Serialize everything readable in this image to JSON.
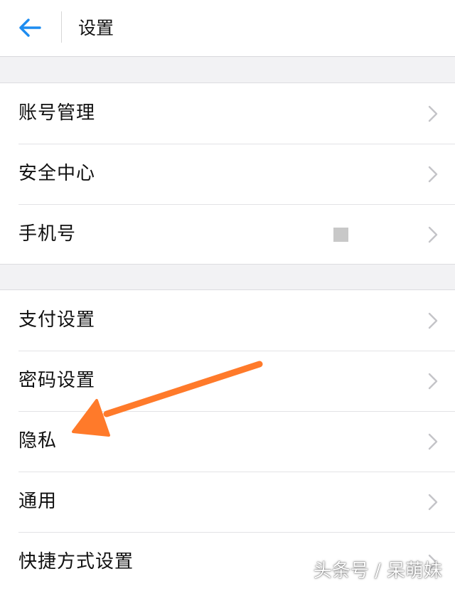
{
  "header": {
    "title": "设置",
    "back_icon": "back-arrow-icon",
    "accent_color": "#1d8cf0"
  },
  "groups": [
    {
      "items": [
        {
          "label": "账号管理",
          "icon": "chevron-right-icon"
        },
        {
          "label": "安全中心",
          "icon": "chevron-right-icon"
        },
        {
          "label": "手机号",
          "icon": "chevron-right-icon",
          "value_masked": true
        }
      ]
    },
    {
      "items": [
        {
          "label": "支付设置",
          "icon": "chevron-right-icon"
        },
        {
          "label": "密码设置",
          "icon": "chevron-right-icon"
        },
        {
          "label": "隐私",
          "icon": "chevron-right-icon"
        },
        {
          "label": "通用",
          "icon": "chevron-right-icon"
        },
        {
          "label": "快捷方式设置",
          "icon": "chevron-right-icon"
        }
      ]
    }
  ],
  "annotation": {
    "arrow_color": "#ff7a2a",
    "points_to": "隐私"
  },
  "watermark": {
    "text": "头条号 / 呆萌妹"
  }
}
